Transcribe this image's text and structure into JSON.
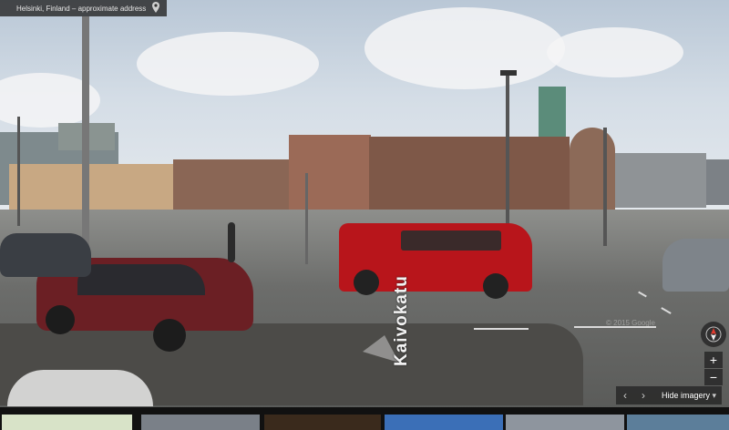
{
  "location": {
    "address": "Helsinki, Finland – approximate address"
  },
  "street": {
    "name": "Kaivokatu"
  },
  "controls": {
    "hide_imagery_label": "Hide imagery",
    "zoom_in": "+",
    "zoom_out": "−"
  },
  "watermark": "© 2015 Google",
  "icons": {
    "pin": "location-pin-icon",
    "compass": "compass-icon",
    "prev": "chevron-left-icon",
    "next": "chevron-right-icon"
  },
  "colors": {
    "van": "#b8151b",
    "car": "#6b1f24",
    "station_brick": "#9b6a57",
    "dome": "#5b8c7a",
    "overlay": "#282828"
  }
}
